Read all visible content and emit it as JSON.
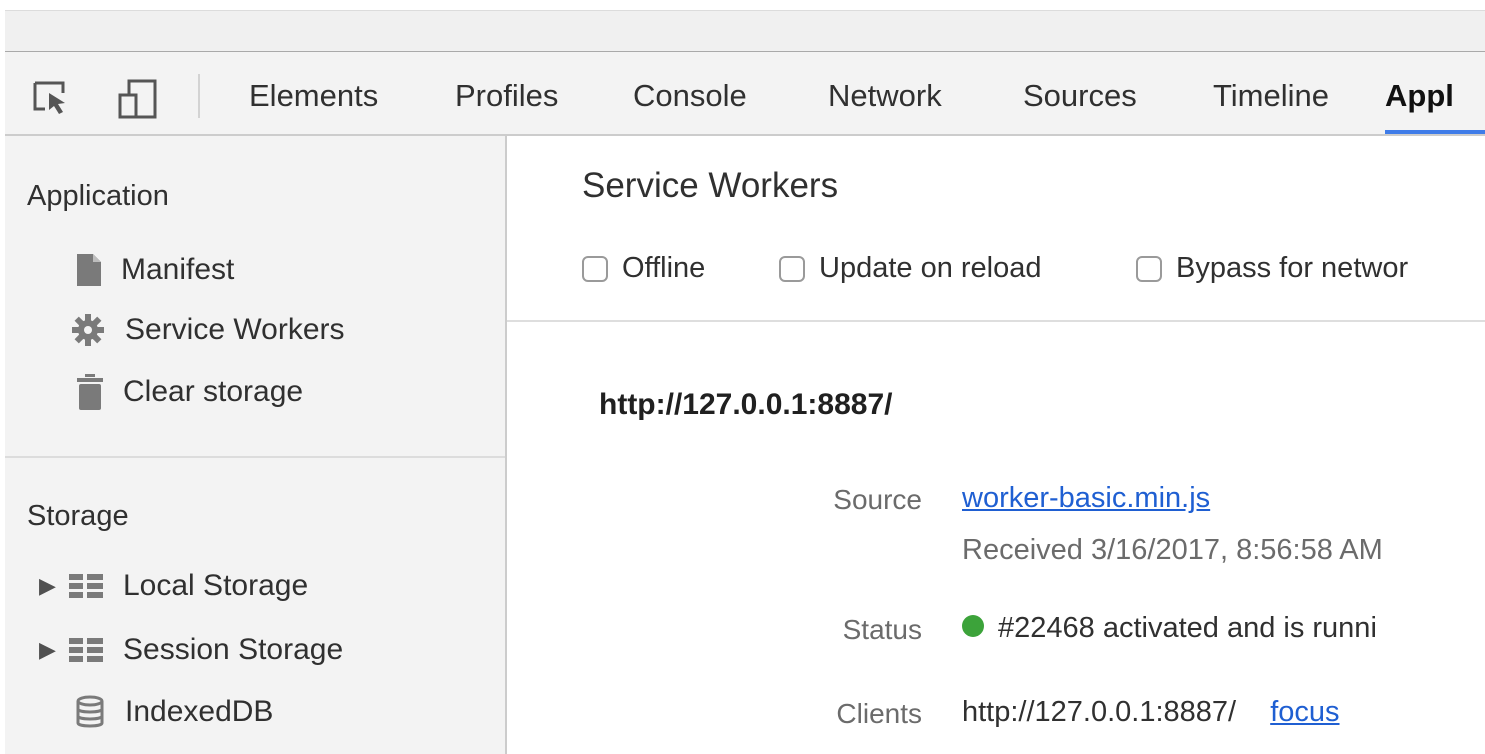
{
  "toolbar": {
    "inspect_icon": "inspect-element-icon",
    "device_icon": "device-mode-icon",
    "tabs": [
      {
        "label": "Elements"
      },
      {
        "label": "Profiles"
      },
      {
        "label": "Console"
      },
      {
        "label": "Network"
      },
      {
        "label": "Sources"
      },
      {
        "label": "Timeline"
      },
      {
        "label": "Appl"
      }
    ],
    "active_tab_index": 6
  },
  "sidebar": {
    "application_section": {
      "title": "Application",
      "items": [
        {
          "label": "Manifest",
          "icon": "document-icon"
        },
        {
          "label": "Service Workers",
          "icon": "gear-icon"
        },
        {
          "label": "Clear storage",
          "icon": "trash-icon"
        }
      ]
    },
    "storage_section": {
      "title": "Storage",
      "items": [
        {
          "label": "Local Storage",
          "icon": "grid-icon",
          "expandable": true
        },
        {
          "label": "Session Storage",
          "icon": "grid-icon",
          "expandable": true
        },
        {
          "label": "IndexedDB",
          "icon": "database-icon",
          "expandable": false
        }
      ]
    }
  },
  "main": {
    "title": "Service Workers",
    "options": [
      {
        "label": "Offline",
        "checked": false
      },
      {
        "label": "Update on reload",
        "checked": false
      },
      {
        "label": "Bypass for networ",
        "checked": false
      }
    ],
    "origin": "http://127.0.0.1:8887/",
    "source": {
      "label": "Source",
      "file": "worker-basic.min.js",
      "received": "Received 3/16/2017, 8:56:58 AM"
    },
    "status": {
      "label": "Status",
      "text": "#22468 activated and is runni",
      "color": "#3ca33a"
    },
    "clients": {
      "label": "Clients",
      "url": "http://127.0.0.1:8887/",
      "focus_link": "focus"
    }
  },
  "colors": {
    "accent": "#3f7ce8",
    "link": "#1f5fd2",
    "sidebar_bg": "#f3f3f3"
  }
}
